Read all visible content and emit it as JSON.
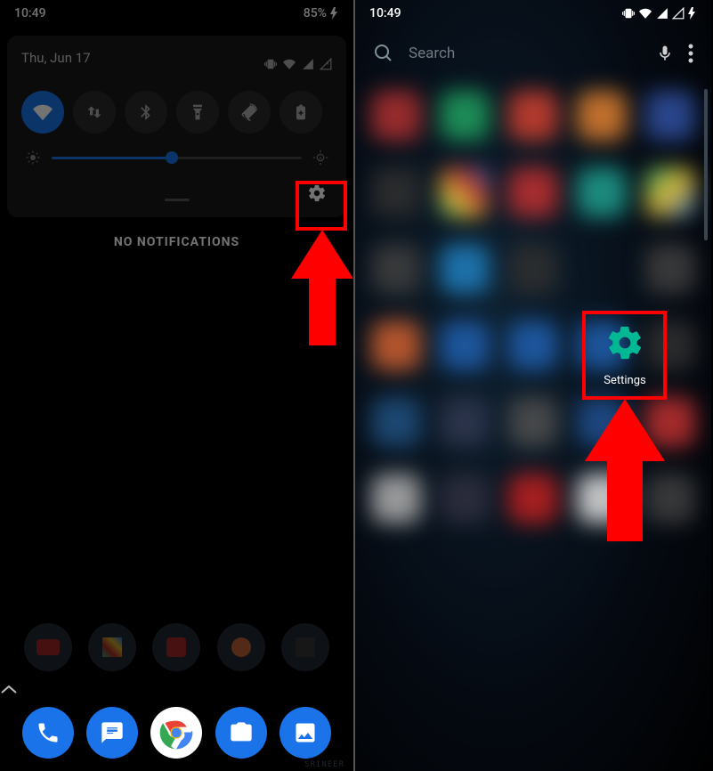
{
  "status": {
    "time": "10:49",
    "battery": "85%"
  },
  "left": {
    "date": "Thu, Jun 17",
    "no_notifications": "NO NOTIFICATIONS",
    "signature": "SRINEER",
    "brightness_pct": 48
  },
  "right": {
    "search_placeholder": "Search",
    "settings_label": "Settings"
  },
  "colors": {
    "accent": "#1a73e8",
    "highlight": "#ff0000",
    "settings_icon": "#00b894"
  }
}
